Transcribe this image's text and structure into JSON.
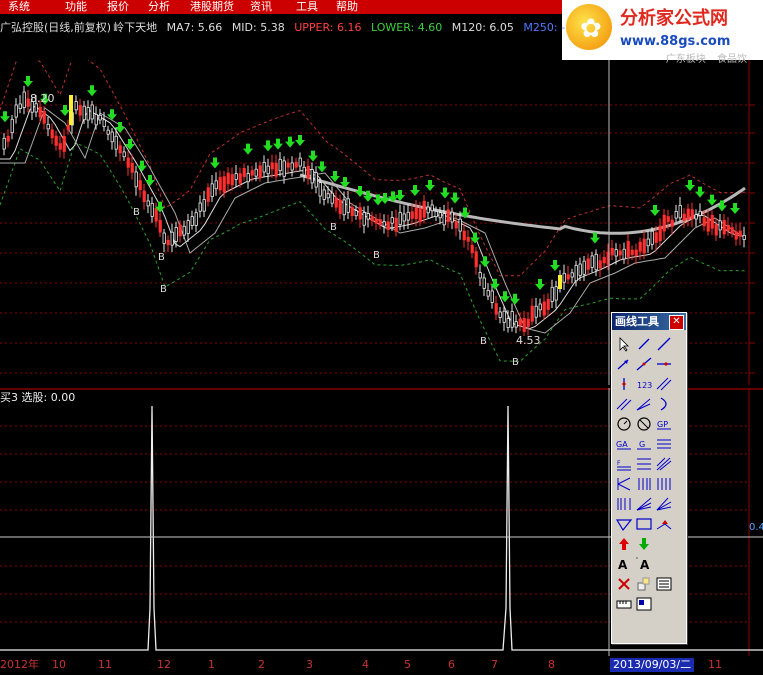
{
  "menu": {
    "items": [
      "系统",
      "功能",
      "报价",
      "分析",
      "港股期货",
      "资讯",
      "工具",
      "帮助"
    ]
  },
  "logo": {
    "title": "分析家公式网",
    "url": "www.88gs.com"
  },
  "stock_info": {
    "name": "广弘控股(日线,前复权)",
    "formula": "岭下天地",
    "ma7": "MA7: 5.66",
    "mid": "MID: 5.38",
    "upper": "UPPER: 6.16",
    "lower": "LOWER: 4.60",
    "m120": "M120: 6.05",
    "m250": "M250: -"
  },
  "sector": {
    "board": "广东板块",
    "industry": "食品饮"
  },
  "chart_labels": {
    "high": "8.20",
    "low": "4.53",
    "buy_marker": "B"
  },
  "indicator": {
    "label": "买3 选股: 0.00",
    "right_value": "0.4"
  },
  "time_axis": {
    "labels": [
      "2012年",
      "10",
      "11",
      "12",
      "1",
      "2",
      "3",
      "4",
      "5",
      "6",
      "7",
      "8",
      "11"
    ],
    "cursor_date": "2013/09/03/二"
  },
  "toolbox": {
    "title": "画线工具",
    "close": "✕",
    "tools": [
      "pointer-icon",
      "line-segment-icon",
      "ray-line-icon",
      "arrow-line-icon",
      "extend-line-icon",
      "horizontal-ray-icon",
      "vertical-line-icon",
      "text-123-icon",
      "parallel-lines-icon",
      "channel-icon",
      "fan-line-icon",
      "arc-icon",
      "circle-icon",
      "cross-circle-icon",
      "gp-icon",
      "ga-icon",
      "g-icon",
      "percent-lines-icon",
      "fibonacci-icon",
      "equal-spacing-icon",
      "gann-lines-icon",
      "cycle-icon",
      "vertical-grid-icon",
      "period-lines-icon",
      "multi-vertical-icon",
      "fan-icon",
      "speed-fan-icon",
      "triangle-icon",
      "rectangle-icon",
      "flag-icon",
      "up-arrow-icon",
      "down-arrow-icon",
      "blank-icon",
      "text-a-icon",
      "text-a-marked-icon",
      "blank-icon",
      "delete-icon",
      "copy-icon",
      "list-icon",
      "ruler-icon",
      "panel-icon"
    ]
  },
  "colors": {
    "menu_bg": "#cc0000",
    "upper": "#ff4040",
    "lower": "#3cd23c",
    "m250": "#5078ff",
    "buy_arrow": "#22dd22",
    "chart_bg": "#000000"
  }
}
